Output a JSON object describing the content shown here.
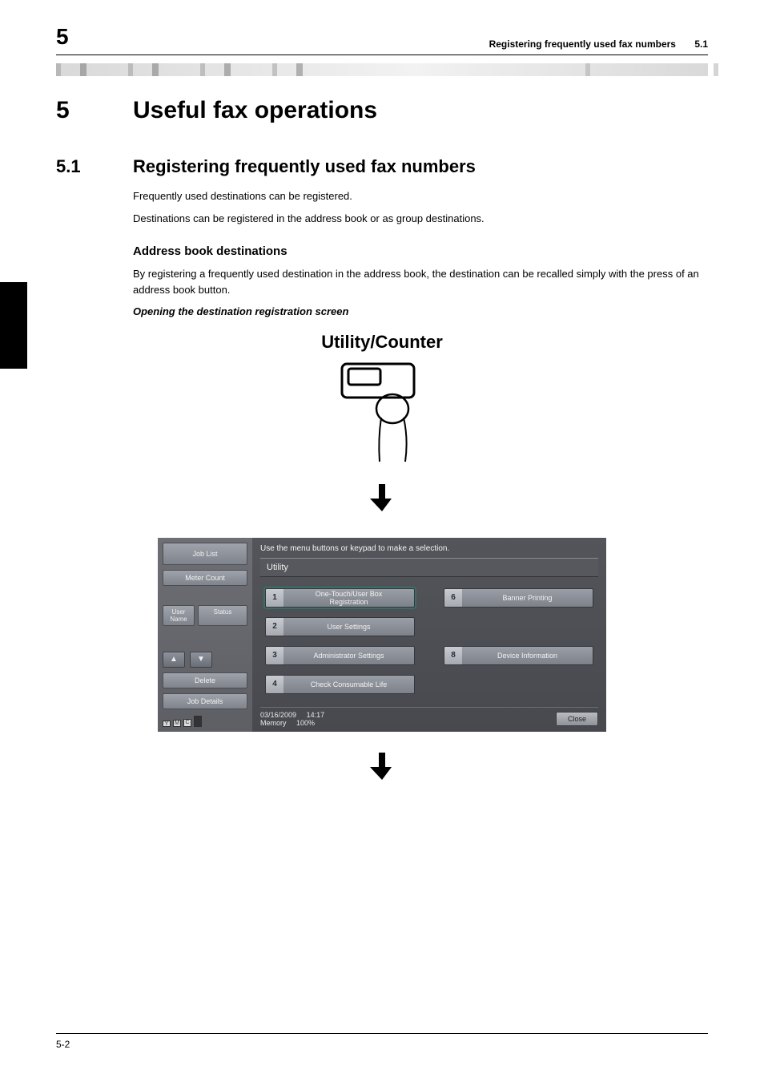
{
  "header": {
    "chapter_num": "5",
    "running_head": "Registering frequently used fax numbers",
    "running_sec": "5.1"
  },
  "chapter": {
    "num": "5",
    "title": "Useful fax operations"
  },
  "section": {
    "num": "5.1",
    "title": "Registering frequently used fax numbers",
    "p1": "Frequently used destinations can be registered.",
    "p2": "Destinations can be registered in the address book or as group destinations."
  },
  "sub": {
    "title": "Address book destinations",
    "p1": "By registering a frequently used destination in the address book, the destination can be recalled simply with the press of an address book button.",
    "runin": "Opening the destination registration screen"
  },
  "fig1": {
    "title": "Utility/Counter"
  },
  "panel": {
    "side": {
      "job_list": "Job List",
      "meter_count": "Meter Count",
      "user_name": "User\nName",
      "status": "Status",
      "delete": "Delete",
      "job_details": "Job Details",
      "toner": {
        "y": "Y",
        "m": "M",
        "c": "C",
        "k": "K"
      }
    },
    "main": {
      "hint": "Use the menu buttons or keypad to make a selection.",
      "title": "Utility",
      "items": [
        {
          "n": "1",
          "label": "One-Touch/User Box\nRegistration",
          "hl": true
        },
        {
          "n": "6",
          "label": "Banner Printing"
        },
        {
          "n": "2",
          "label": "User Settings"
        },
        {
          "n": "",
          "label": "",
          "blank": true
        },
        {
          "n": "3",
          "label": "Administrator Settings"
        },
        {
          "n": "8",
          "label": "Device Information"
        },
        {
          "n": "4",
          "label": "Check Consumable Life"
        },
        {
          "n": "",
          "label": "",
          "blank": true
        }
      ],
      "footer": {
        "date": "03/16/2009",
        "time": "14:17",
        "mem_label": "Memory",
        "mem_value": "100%",
        "close": "Close"
      }
    }
  },
  "footer": {
    "page": "5-2"
  }
}
